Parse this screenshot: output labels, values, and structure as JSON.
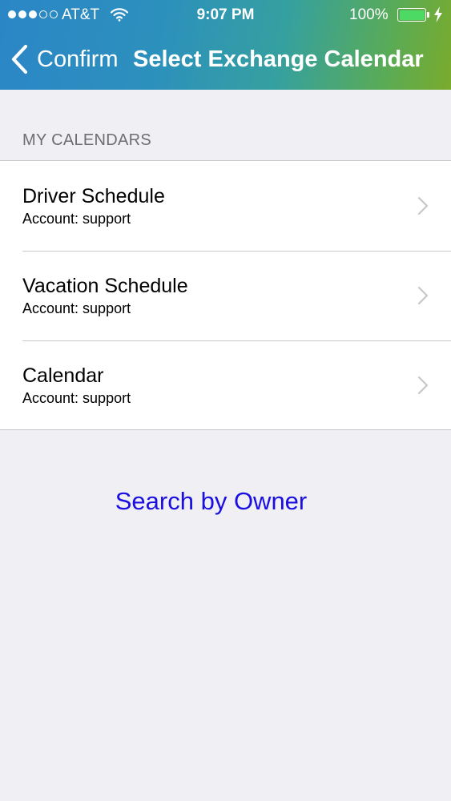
{
  "status_bar": {
    "carrier": "AT&T",
    "time": "9:07 PM",
    "battery_percent": "100%",
    "signal_bars": 3,
    "signal_total": 5
  },
  "nav": {
    "back_label": "Confirm",
    "title": "Select Exchange Calendar"
  },
  "section": {
    "header": "MY CALENDARS"
  },
  "calendars": [
    {
      "name": "Driver Schedule",
      "account": "Account: support"
    },
    {
      "name": "Vacation Schedule",
      "account": "Account: support"
    },
    {
      "name": "Calendar",
      "account": "Account: support"
    }
  ],
  "search_link": {
    "label": "Search by Owner",
    "color": "#1a0fe0"
  },
  "colors": {
    "battery_fill": "#4cd964",
    "background": "#efeff4",
    "chevron": "#c7c7cc"
  },
  "icons": {
    "back": "chevron-left-icon",
    "row_disclosure": "chevron-right-icon",
    "wifi": "wifi-icon",
    "battery": "battery-icon",
    "charging": "lightning-bolt-icon"
  }
}
